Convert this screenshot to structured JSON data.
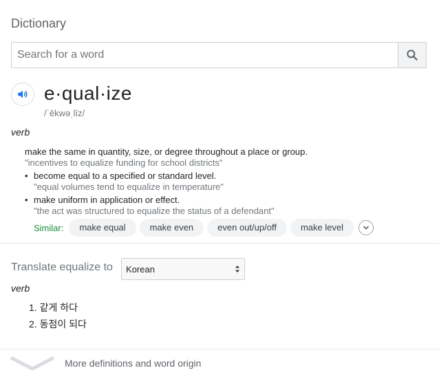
{
  "card": {
    "title": "Dictionary"
  },
  "search": {
    "placeholder": "Search for a word",
    "value": ""
  },
  "entry": {
    "word": "e·qual·ize",
    "phonetic": "/ˈēkwəˌlīz/",
    "part_of_speech": "verb",
    "definitions": [
      {
        "text": "make the same in quantity, size, or degree throughout a place or group.",
        "example": "\"incentives to equalize funding for school districts\""
      },
      {
        "text": "become equal to a specified or standard level.",
        "example": "\"equal volumes tend to equalize in temperature\""
      },
      {
        "text": "make uniform in application or effect.",
        "example": "\"the act was structured to equalize the status of a defendant\""
      }
    ],
    "similar_label": "Similar:",
    "similar": [
      "make equal",
      "make even",
      "even out/up/off",
      "make level"
    ]
  },
  "translate": {
    "label": "Translate equalize to",
    "language": "Korean",
    "part_of_speech": "verb",
    "items": [
      "1. 같게 하다",
      "2. 동점이 되다"
    ]
  },
  "footer": {
    "more_label": "More definitions and word origin"
  },
  "icons": {
    "search": "search-icon",
    "audio": "speaker-icon",
    "expand": "chevron-down-icon",
    "select": "up-down-arrows-icon",
    "more": "chevron-down-icon"
  },
  "colors": {
    "similar_label": "#1e8e3e",
    "accent_blue": "#1a73e8"
  }
}
